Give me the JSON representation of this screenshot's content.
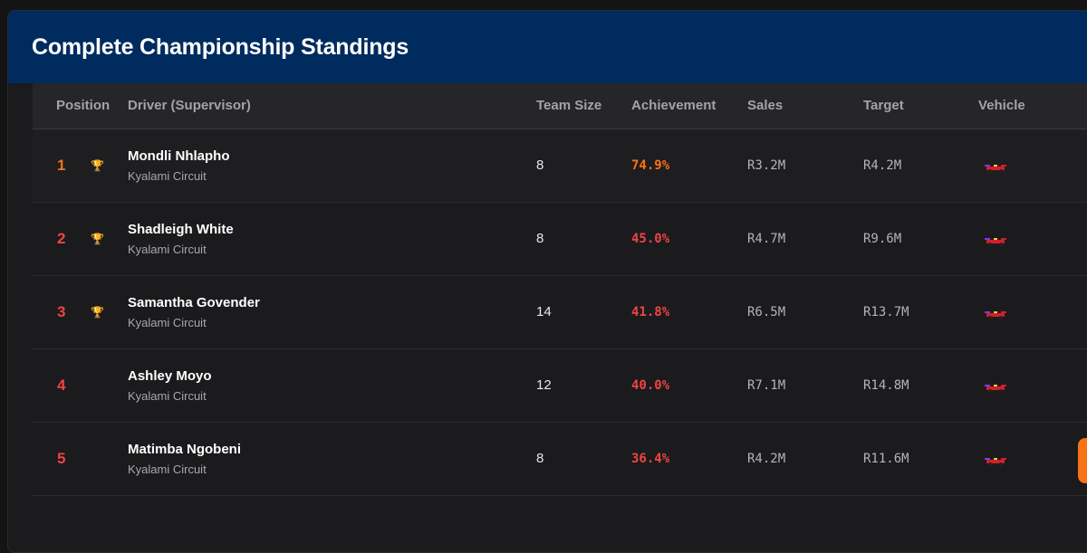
{
  "title": "Complete Championship Standings",
  "columns": [
    "Position",
    "Driver (Supervisor)",
    "Team Size",
    "Achievement",
    "Sales",
    "Target",
    "Vehicle"
  ],
  "colors": {
    "header_bg": "#002b5e",
    "achievement_top": "#f97316",
    "achievement": "#ef4444"
  },
  "rows": [
    {
      "position": "1",
      "trophy": "🏆",
      "name": "Mondli Nhlapho",
      "circuit": "Kyalami Circuit",
      "team_size": "8",
      "achievement": "74.9%",
      "sales": "R3.2M",
      "target": "R4.2M",
      "vehicle_icon": "race-car-icon"
    },
    {
      "position": "2",
      "trophy": "🏆",
      "name": "Shadleigh White",
      "circuit": "Kyalami Circuit",
      "team_size": "8",
      "achievement": "45.0%",
      "sales": "R4.7M",
      "target": "R9.6M",
      "vehicle_icon": "race-car-icon"
    },
    {
      "position": "3",
      "trophy": "🏆",
      "name": "Samantha Govender",
      "circuit": "Kyalami Circuit",
      "team_size": "14",
      "achievement": "41.8%",
      "sales": "R6.5M",
      "target": "R13.7M",
      "vehicle_icon": "race-car-icon"
    },
    {
      "position": "4",
      "trophy": "",
      "name": "Ashley Moyo",
      "circuit": "Kyalami Circuit",
      "team_size": "12",
      "achievement": "40.0%",
      "sales": "R7.1M",
      "target": "R14.8M",
      "vehicle_icon": "race-car-icon"
    },
    {
      "position": "5",
      "trophy": "",
      "name": "Matimba Ngobeni",
      "circuit": "Kyalami Circuit",
      "team_size": "8",
      "achievement": "36.4%",
      "sales": "R4.2M",
      "target": "R11.6M",
      "vehicle_icon": "race-car-icon"
    }
  ]
}
